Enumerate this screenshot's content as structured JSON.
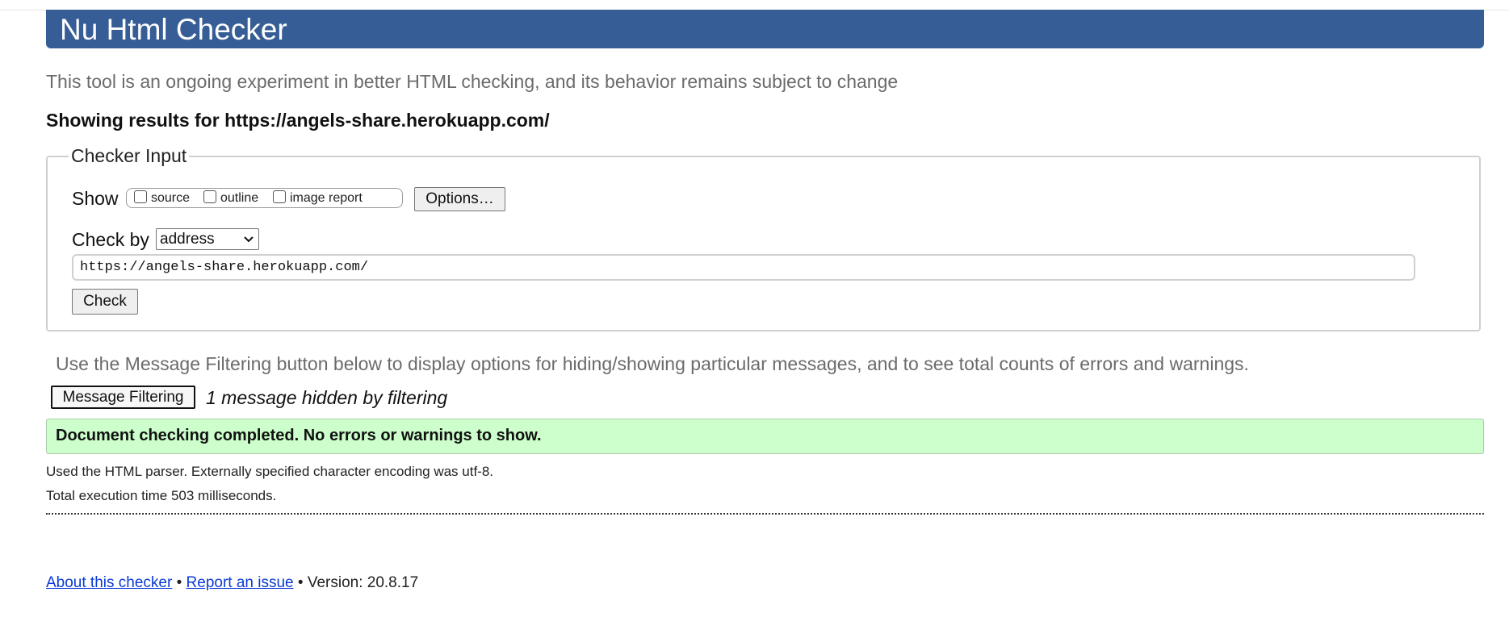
{
  "header": {
    "title": "Nu Html Checker",
    "color": "#365d95"
  },
  "tagline": "This tool is an ongoing experiment in better HTML checking, and its behavior remains subject to change",
  "results_heading": "Showing results for https://angels-share.herokuapp.com/",
  "checker_input": {
    "legend": "Checker Input",
    "show_label": "Show",
    "show_options": [
      {
        "label": "source",
        "checked": false
      },
      {
        "label": "outline",
        "checked": false
      },
      {
        "label": "image report",
        "checked": false
      }
    ],
    "options_button": "Options…",
    "check_by_label": "Check by",
    "check_by_selected": "address",
    "url_value": "https://angels-share.herokuapp.com/",
    "check_button": "Check"
  },
  "filtering": {
    "help_text": "Use the Message Filtering button below to display options for hiding/showing particular messages, and to see total counts of errors and warnings.",
    "button_label": "Message Filtering",
    "hidden_count_text": "1 message hidden by filtering"
  },
  "result": {
    "success_text": "Document checking completed. No errors or warnings to show.",
    "success_color": "#ccffcc",
    "parser_info": "Used the HTML parser. Externally specified character encoding was utf-8.",
    "exec_time": "Total execution time 503 milliseconds."
  },
  "footer": {
    "about_link": "About this checker",
    "separator": "•",
    "report_link": "Report an issue",
    "version_text": "Version: 20.8.17"
  }
}
